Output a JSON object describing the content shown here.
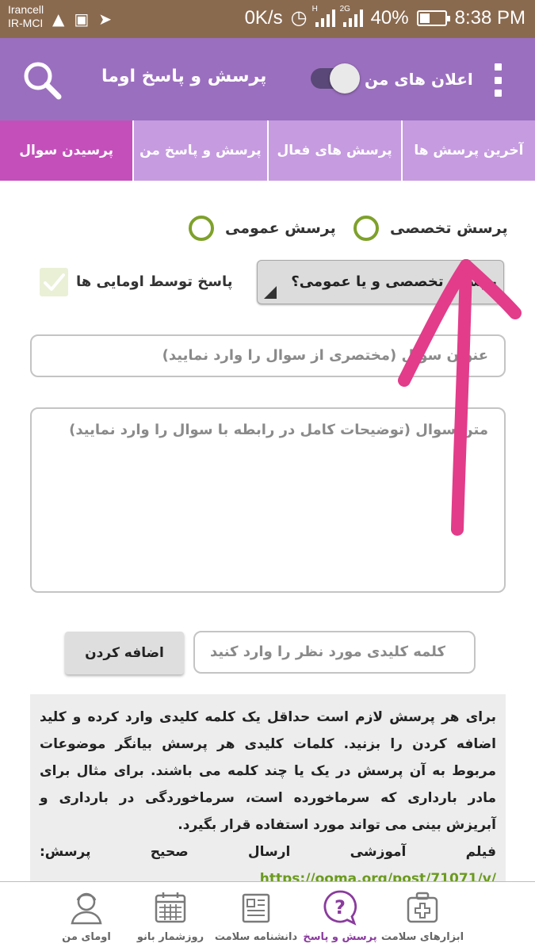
{
  "status_bar": {
    "carrier_line1": "Irancell",
    "carrier_line2": "IR-MCI",
    "net_speed": "0K/s",
    "net_type_1": "H",
    "net_type_2": "2G",
    "battery_pct": "40%",
    "battery_level": 0.4,
    "time": "8:38 PM"
  },
  "app_bar": {
    "title": "پرسش و پاسخ اوما",
    "notifications_label": "اعلان های من",
    "notifications_enabled": false
  },
  "tabs": [
    {
      "label": "آخرین پرسش ها",
      "active": false
    },
    {
      "label": "پرسش های فعال",
      "active": false
    },
    {
      "label": "پرسش و پاسخ من",
      "active": false
    },
    {
      "label": "پرسیدن سوال",
      "active": true
    }
  ],
  "question_type": {
    "specialized": "پرسش تخصصی",
    "general": "پرسش عمومی",
    "dropdown_value": "پرسش تخصصی و یا عمومی؟"
  },
  "answer_by_oomas": {
    "label": "پاسخ توسط اومایی ها",
    "checked": false
  },
  "form": {
    "title_placeholder": "عنوان سوال (مختصری از سوال را وارد نمایید)",
    "body_placeholder": "متن سوال (توضیحات کامل در رابطه با سوال را وارد نمایید)",
    "keyword_placeholder": "کلمه کلیدی مورد نظر را وارد کنید",
    "add_button": "اضافه کردن"
  },
  "help": {
    "text": "برای هر پرسش لازم است حداقل یک کلمه کلیدی وارد کرده و کلید اضافه کردن را بزنید. کلمات کلیدی هر پرسش بیانگر موضوعات مربوط به آن پرسش در یک یا چند کلمه می باشند. برای مثال برای مادر بارداری که سرماخورده است، سرماخوردگی در بارداری و آبریزش بینی می تواند مورد استفاده قرار بگیرد.",
    "video_label": "فیلم آموزشی ارسال صحیح پرسش:",
    "video_link": "https://ooma.org/post/71071/v/"
  },
  "bottom_nav": [
    {
      "label": "ابزارهای سلامت",
      "icon": "medical-kit-icon",
      "active": false
    },
    {
      "label": "پرسش و پاسخ",
      "icon": "question-bubble-icon",
      "active": true
    },
    {
      "label": "دانشنامه سلامت",
      "icon": "encyclopedia-icon",
      "active": false
    },
    {
      "label": "روزشمار بانو",
      "icon": "calendar-icon",
      "active": false
    },
    {
      "label": "اومای من",
      "icon": "profile-icon",
      "active": false
    }
  ],
  "colors": {
    "app_bar": "#9b6fbf",
    "tab_bar": "#c69be0",
    "active_tab": "#c44fbb",
    "radio": "#7ea12b",
    "link": "#6b9a1f",
    "annotation_arrow": "#e23c8a"
  }
}
